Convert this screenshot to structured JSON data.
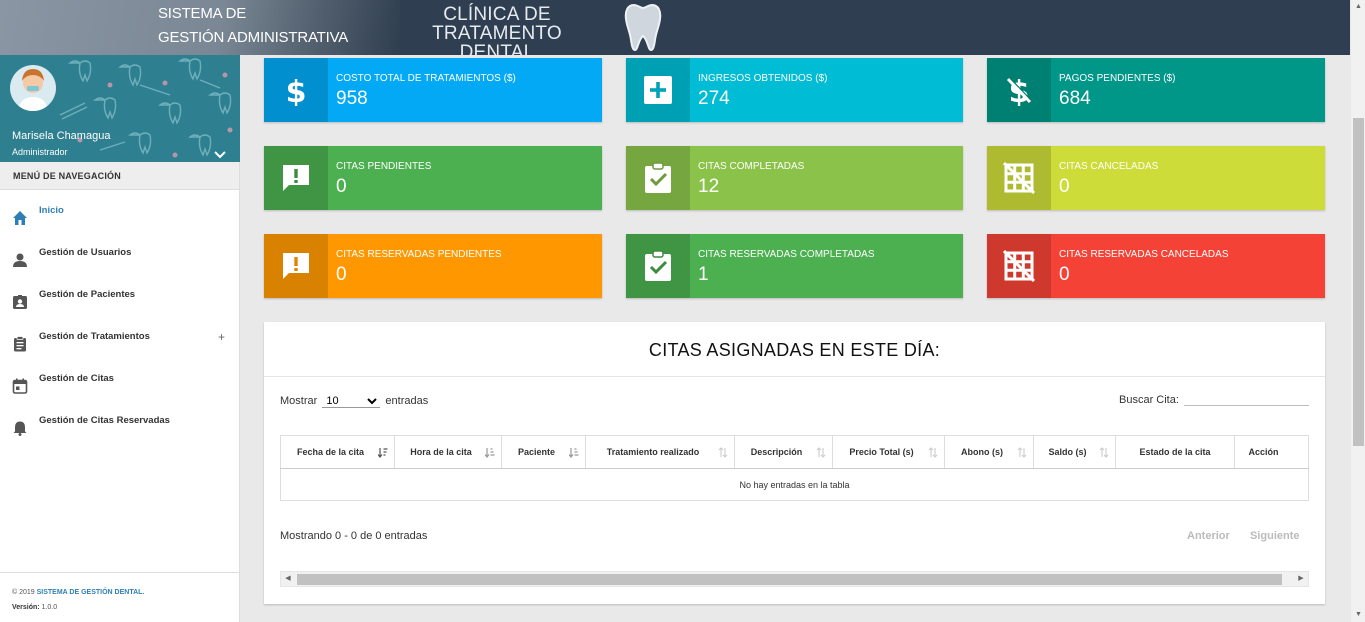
{
  "header": {
    "system_line1": "SISTEMA DE",
    "system_line2": "GESTIÓN ADMINISTRATIVA",
    "clinic_line1": "CLÍNICA DE TRATAMENTO",
    "clinic_line2": "DENTAL",
    "logo_icon": "tooth-icon"
  },
  "profile": {
    "name": "Marisela Chamagua",
    "role": "Administrador"
  },
  "sidebar": {
    "nav_header": "MENÚ DE NAVEGACIÓN",
    "items": [
      {
        "label": "Inicio",
        "icon": "home-icon",
        "active": true
      },
      {
        "label": "Gestión de Usuarios",
        "icon": "user-icon"
      },
      {
        "label": "Gestión de Pacientes",
        "icon": "id-card-icon"
      },
      {
        "label": "Gestión de Tratamientos",
        "icon": "clipboard-icon",
        "expand": "+"
      },
      {
        "label": "Gestión de Citas",
        "icon": "calendar-icon"
      },
      {
        "label": "Gestión de Citas Reservadas",
        "icon": "bell-icon"
      }
    ],
    "footer": {
      "copyright": "© 2019 ",
      "brand": "SISTEMA DE GESTIÓN DENTAL.",
      "version_label": "Versión:",
      "version": " 1.0.0"
    }
  },
  "boxes": [
    {
      "label": "COSTO TOTAL DE TRATAMIENTOS ($)",
      "value": "958",
      "color": "#03a9f4",
      "icon": "dollar-icon"
    },
    {
      "label": "INGRESOS OBTENIDOS ($)",
      "value": "274",
      "color": "#00bcd4",
      "icon": "plus-box-icon"
    },
    {
      "label": "PAGOS PENDIENTES ($)",
      "value": "684",
      "color": "#009688",
      "icon": "dollar-off-icon"
    },
    {
      "label": "CITAS PENDIENTES",
      "value": "0",
      "color": "#4caf50",
      "icon": "alert-comment-icon"
    },
    {
      "label": "CITAS COMPLETADAS",
      "value": "12",
      "color": "#8bc34a",
      "icon": "clipboard-check-icon"
    },
    {
      "label": "CITAS CANCELADAS",
      "value": "0",
      "color": "#cddc39",
      "icon": "grid-off-icon"
    },
    {
      "label": "CITAS RESERVADAS PENDIENTES",
      "value": "0",
      "color": "#ff9800",
      "icon": "alert-comment-icon"
    },
    {
      "label": "CITAS RESERVADAS COMPLETADAS",
      "value": "1",
      "color": "#4caf50",
      "icon": "clipboard-check-icon"
    },
    {
      "label": "CITAS RESERVADAS CANCELADAS",
      "value": "0",
      "color": "#f44336",
      "icon": "grid-off-icon"
    }
  ],
  "table_card": {
    "title": "CITAS ASIGNADAS EN ESTE DÍA:",
    "show_prefix": "Mostrar",
    "show_value": "10",
    "show_options": [
      "10"
    ],
    "show_suffix": "entradas",
    "search_label": "Buscar Cita:",
    "search_value": "",
    "columns": [
      "Fecha de la cita",
      "Hora de la cita",
      "Paciente",
      "Tratamiento realizado",
      "Descripción",
      "Precio Total (s)",
      "Abono (s)",
      "Saldo (s)",
      "Estado de la cita",
      "Acción"
    ],
    "empty_message": "No hay entradas en la tabla",
    "info": "Mostrando 0 - 0 de 0 entradas",
    "prev": "Anterior",
    "next": "Siguiente"
  }
}
